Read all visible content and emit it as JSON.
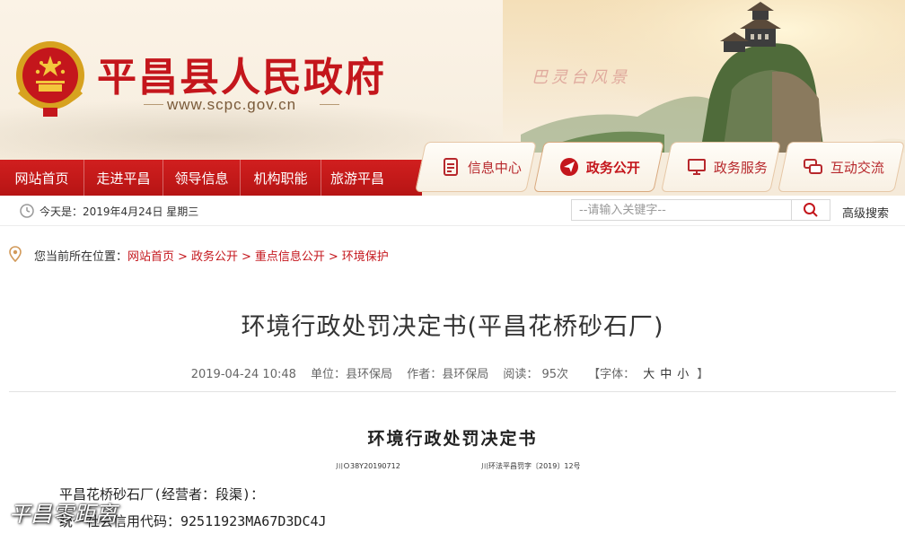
{
  "header": {
    "site_name": "平昌县人民政府",
    "site_url": "www.scpc.gov.cn",
    "scenery_caption": "巴灵台风景"
  },
  "nav_left": [
    {
      "label": "网站首页"
    },
    {
      "label": "走进平昌"
    },
    {
      "label": "领导信息"
    },
    {
      "label": "机构职能"
    },
    {
      "label": "旅游平昌"
    }
  ],
  "nav_tabs": [
    {
      "label": "信息中心",
      "icon": "document-icon"
    },
    {
      "label": "政务公开",
      "icon": "send-icon",
      "active": true
    },
    {
      "label": "政务服务",
      "icon": "monitor-icon"
    },
    {
      "label": "互动交流",
      "icon": "chat-icon"
    }
  ],
  "infobar": {
    "today": "今天是：2019年4月24日 星期三",
    "search_placeholder": "--请输入关键字--",
    "advanced_search": "高级搜索"
  },
  "breadcrumb": {
    "prefix": "您当前所在位置：",
    "items": [
      "网站首页",
      "政务公开",
      "重点信息公开",
      "环境保护"
    ]
  },
  "article": {
    "title": "环境行政处罚决定书(平昌花桥砂石厂)",
    "date": "2019-04-24 10:48",
    "unit": "单位：县环保局",
    "author": "作者：县环保局",
    "views": "阅读： 95次",
    "font_label": "【字体：",
    "font_sizes": [
      "大",
      "中",
      "小"
    ],
    "font_close": "】",
    "doc_title": "环境行政处罚决定书",
    "doc_no_left": "川Ｏ38Y20190712",
    "doc_no_right": "川环法平昌罚字〔2019〕12号",
    "line1": "平昌花桥砂石厂(经营者：段渠)：",
    "line2": "统一社会信用代码：92511923MA67D3DC4J"
  },
  "watermark": "平昌零距离",
  "colors": {
    "brand_red": "#c4161c",
    "nav_red": "#d11f1f",
    "banner_bg": "#f8efe1"
  }
}
